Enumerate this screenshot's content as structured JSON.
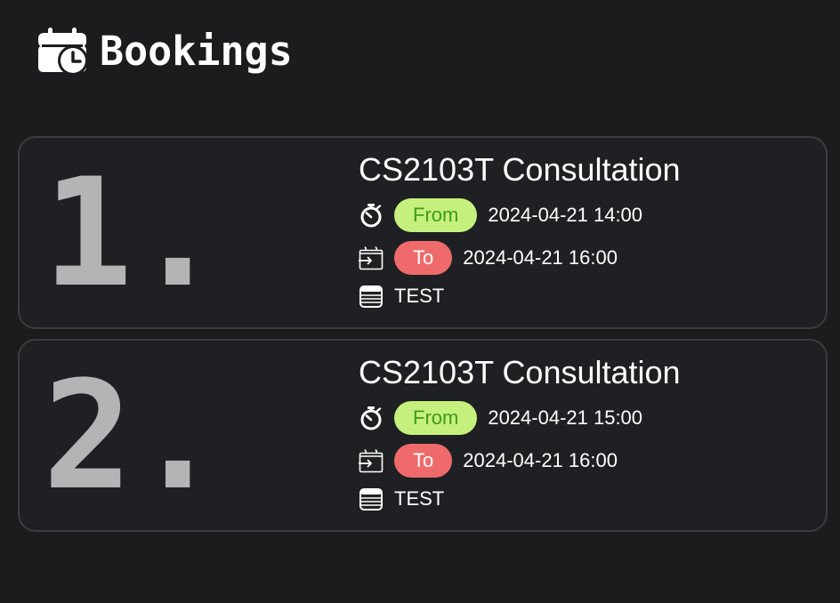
{
  "header": {
    "title": "Bookings",
    "icon": "calendar-clock-icon"
  },
  "bookings": [
    {
      "index": "1.",
      "title": "CS2103T Consultation",
      "from_label": "From",
      "from": "2024-04-21 14:00",
      "to_label": "To",
      "to": "2024-04-21 16:00",
      "note": "TEST"
    },
    {
      "index": "2.",
      "title": "CS2103T Consultation",
      "from_label": "From",
      "from": "2024-04-21 15:00",
      "to_label": "To",
      "to": "2024-04-21 16:00",
      "note": "TEST"
    }
  ],
  "icons": {
    "from": "stopwatch-icon",
    "to": "calendar-arrow-icon",
    "note": "notes-icon"
  },
  "colors": {
    "background": "#1c1c1e",
    "card": "#1f2023",
    "from_pill": "#c6f07d",
    "from_text": "#3f9a1f",
    "to_pill": "#ef6b6b",
    "index_text": "#b3b4b6"
  }
}
